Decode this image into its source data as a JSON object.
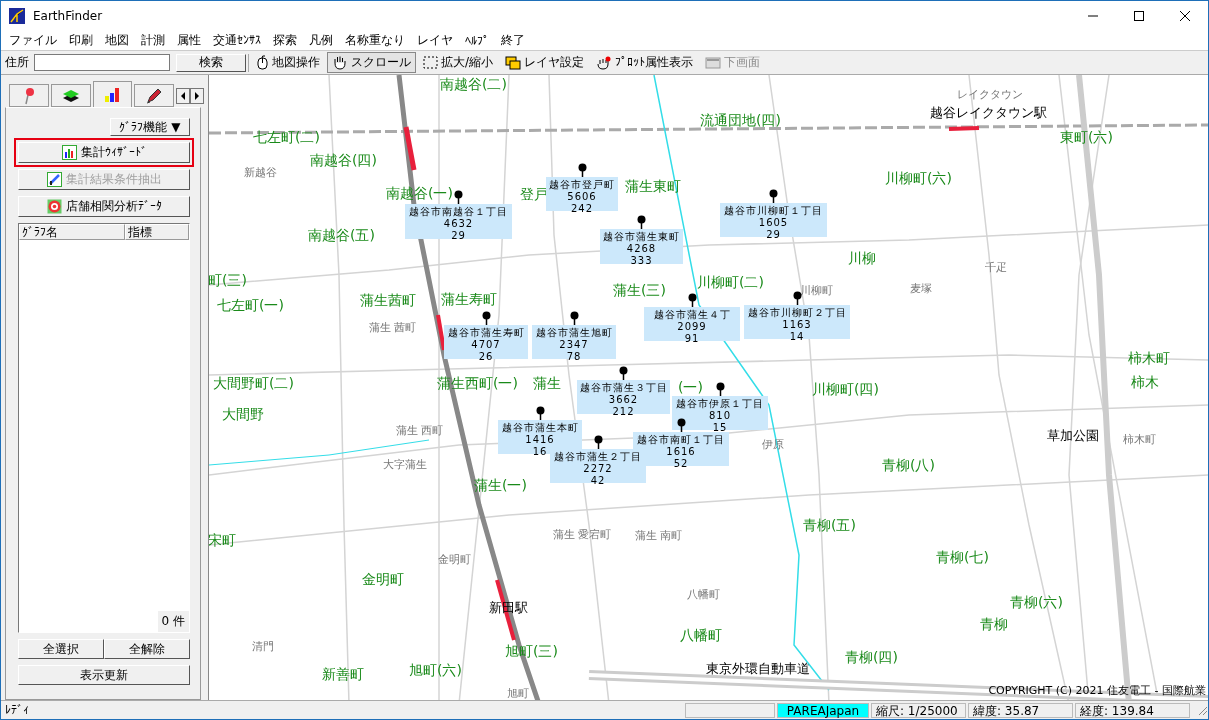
{
  "window": {
    "title": "EarthFinder"
  },
  "menu": [
    "ファイル",
    "印刷",
    "地図",
    "計測",
    "属性",
    "交通ｾﾝｻｽ",
    "探索",
    "凡例",
    "名称重なり",
    "レイヤ",
    "ﾍﾙﾌﾟ",
    "終了"
  ],
  "toolbar": {
    "address_label": "住所",
    "search_button": "検索",
    "tools": [
      {
        "kind": "mouse",
        "label": "地図操作",
        "selected": false,
        "disabled": false
      },
      {
        "kind": "hand",
        "label": "スクロール",
        "selected": true,
        "disabled": false
      },
      {
        "kind": "zoom",
        "label": "拡大/縮小",
        "selected": false,
        "disabled": false
      },
      {
        "kind": "layers",
        "label": "レイヤ設定",
        "selected": false,
        "disabled": false
      },
      {
        "kind": "plot",
        "label": "ﾌﾟﾛｯﾄ属性表示",
        "selected": false,
        "disabled": false
      },
      {
        "kind": "screen",
        "label": "下画面",
        "selected": false,
        "disabled": true
      }
    ]
  },
  "left_panel": {
    "tabs": [
      {
        "kind": "pin",
        "selected": false
      },
      {
        "kind": "layers",
        "selected": false
      },
      {
        "kind": "chart",
        "selected": true
      },
      {
        "kind": "pencil",
        "selected": false
      }
    ],
    "graph_menu": "ｸﾞﾗﾌ機能 ▼",
    "buttons": [
      {
        "kind": "chart",
        "label": "集計ｳｨｻﾞｰﾄﾞ",
        "disabled": false,
        "highlighted": true
      },
      {
        "kind": "extract",
        "label": "集計結果条件抽出",
        "disabled": true,
        "highlighted": false
      },
      {
        "kind": "target",
        "label": "店舗相関分析ﾃﾞｰﾀ",
        "disabled": false,
        "highlighted": false
      }
    ],
    "list": {
      "columns": [
        "ｸﾞﾗﾌ名",
        "指標"
      ],
      "count": "0 件"
    },
    "select_all": "全選択",
    "deselect_all": "全解除",
    "refresh": "表示更新"
  },
  "map": {
    "labels": [
      {
        "kind": "area",
        "text": "南越谷(二)"
      },
      {
        "kind": "area",
        "text": "七左町(二)"
      },
      {
        "kind": "area",
        "text": "南越谷(四)"
      },
      {
        "kind": "area",
        "text": "流通団地(四)"
      },
      {
        "kind": "landmark",
        "text": "越谷レイクタウン駅"
      },
      {
        "kind": "area",
        "text": "東町(六)"
      },
      {
        "kind": "area",
        "text": "南越谷(一)"
      },
      {
        "kind": "area",
        "text": "登戸"
      },
      {
        "kind": "area",
        "text": "蒲生東町"
      },
      {
        "kind": "area",
        "text": "川柳町(六)"
      },
      {
        "kind": "area",
        "text": "南越谷(五)"
      },
      {
        "kind": "area",
        "text": "川柳"
      },
      {
        "kind": "area",
        "text": "町(三)"
      },
      {
        "kind": "area",
        "text": "蒲生茜町"
      },
      {
        "kind": "area",
        "text": "蒲生寿町"
      },
      {
        "kind": "area",
        "text": "蒲生(三)"
      },
      {
        "kind": "area",
        "text": "川柳町(二)"
      },
      {
        "kind": "area",
        "text": "七左町(一)"
      },
      {
        "kind": "area",
        "text": "大間野町(二)"
      },
      {
        "kind": "area",
        "text": "蒲生西町(一)"
      },
      {
        "kind": "area",
        "text": "蒲生"
      },
      {
        "kind": "area",
        "text": "(一)"
      },
      {
        "kind": "area",
        "text": "川柳町(四)"
      },
      {
        "kind": "area",
        "text": "大間野"
      },
      {
        "kind": "area",
        "text": "柿木町"
      },
      {
        "kind": "area",
        "text": "柿木"
      },
      {
        "kind": "landmark",
        "text": "草加公園"
      },
      {
        "kind": "area",
        "text": "青柳(八)"
      },
      {
        "kind": "area",
        "text": "蒲生(一)"
      },
      {
        "kind": "area",
        "text": "宋町"
      },
      {
        "kind": "area",
        "text": "青柳(五)"
      },
      {
        "kind": "area",
        "text": "青柳(七)"
      },
      {
        "kind": "area",
        "text": "金明町"
      },
      {
        "kind": "landmark",
        "text": "新田駅"
      },
      {
        "kind": "area",
        "text": "青柳(六)"
      },
      {
        "kind": "area",
        "text": "青柳"
      },
      {
        "kind": "area",
        "text": "八幡町"
      },
      {
        "kind": "area",
        "text": "新善町"
      },
      {
        "kind": "area",
        "text": "旭町(六)"
      },
      {
        "kind": "area",
        "text": "旭町(三)"
      },
      {
        "kind": "area",
        "text": "青柳(四)"
      },
      {
        "kind": "landmark",
        "text": "東京外環自動車道"
      },
      {
        "kind": "minor",
        "text": "レイクタウン"
      },
      {
        "kind": "minor",
        "text": "新越谷"
      },
      {
        "kind": "minor",
        "text": "千疋"
      },
      {
        "kind": "minor",
        "text": "川柳町"
      },
      {
        "kind": "minor",
        "text": "麦塚"
      },
      {
        "kind": "minor",
        "text": "蒲生 茜町"
      },
      {
        "kind": "minor",
        "text": "蒲生 西町"
      },
      {
        "kind": "minor",
        "text": "大字蒲生"
      },
      {
        "kind": "minor",
        "text": "金明町"
      },
      {
        "kind": "minor",
        "text": "蒲生 愛宕町"
      },
      {
        "kind": "minor",
        "text": "蒲生 南町"
      },
      {
        "kind": "minor",
        "text": "八幡町"
      },
      {
        "kind": "minor",
        "text": "清門"
      },
      {
        "kind": "minor",
        "text": "旭町"
      },
      {
        "kind": "minor",
        "text": "柿木町"
      },
      {
        "kind": "minor",
        "text": "伊原"
      }
    ],
    "callouts": [
      {
        "name": "越谷市南越谷１丁目",
        "value_1": "4632",
        "value_2": "29"
      },
      {
        "name": "越谷市登戸町",
        "value_1": "5606",
        "value_2": "242"
      },
      {
        "name": "越谷市蒲生東町",
        "value_1": "4268",
        "value_2": "333"
      },
      {
        "name": "越谷市川柳町１丁目",
        "value_1": "1605",
        "value_2": "29"
      },
      {
        "name": "越谷市蒲生４丁",
        "value_1": "2099",
        "value_2": "91"
      },
      {
        "name": "越谷市川柳町２丁目",
        "value_1": "1163",
        "value_2": "14"
      },
      {
        "name": "越谷市蒲生寿町",
        "value_1": "4707",
        "value_2": "26"
      },
      {
        "name": "越谷市蒲生旭町",
        "value_1": "2347",
        "value_2": "78"
      },
      {
        "name": "越谷市蒲生３丁目",
        "value_1": "3662",
        "value_2": "212"
      },
      {
        "name": "越谷市伊原１丁目",
        "value_1": "810",
        "value_2": "15"
      },
      {
        "name": "越谷市蒲生本町",
        "value_1": "1416",
        "value_2": "16"
      },
      {
        "name": "越谷市南町１丁目",
        "value_1": "1616",
        "value_2": "52"
      },
      {
        "name": "越谷市蒲生２丁目",
        "value_1": "2272",
        "value_2": "42"
      }
    ],
    "copyright": "COPYRIGHT (C) 2021 住友電工 - 国際航業"
  },
  "status_bar": {
    "message": "ﾚﾃﾞｨ",
    "source": "PAREAJapan",
    "scale": "縮尺: 1/25000",
    "latitude": "緯度: 35.87",
    "longitude": "経度: 139.84"
  }
}
